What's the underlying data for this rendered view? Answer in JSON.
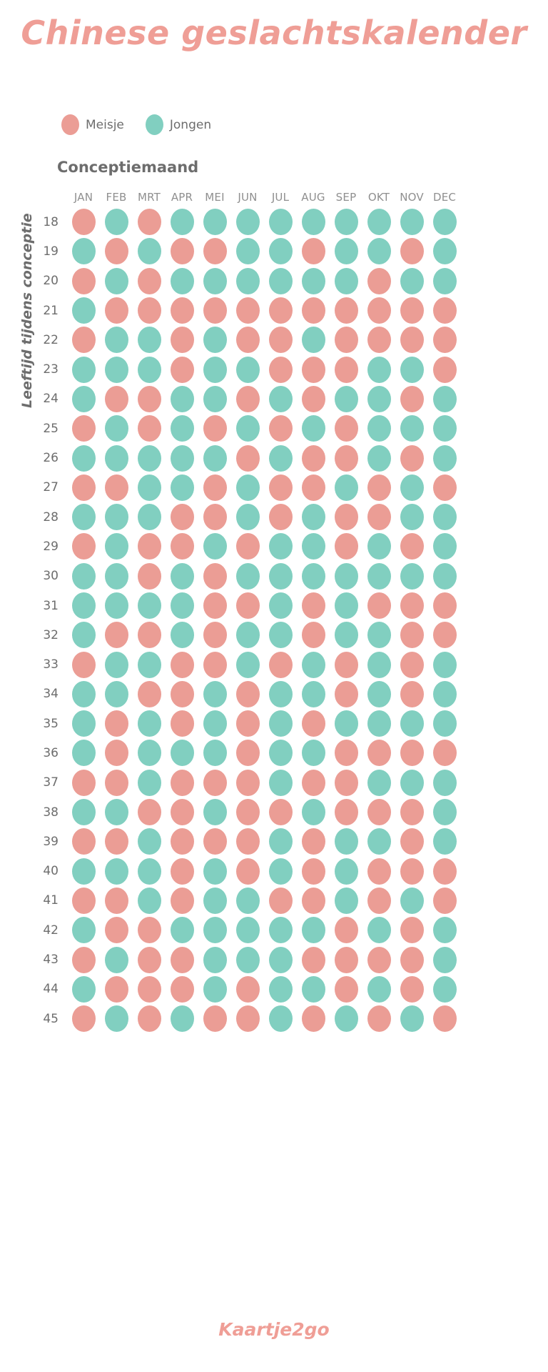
{
  "title": "Chinese geslachtskalender",
  "footer": "Kaartje2go",
  "legend": {
    "girl_label": "Meisje",
    "boy_label": "Jongen",
    "girl_color": "#eb9d95",
    "boy_color": "#81cfc0"
  },
  "axes": {
    "x_title": "Conceptiemaand",
    "y_title": "Leeftijd tijdens conceptie"
  },
  "chart_data": {
    "type": "heatmap",
    "title": "Chinese geslachtskalender",
    "xlabel": "Conceptiemaand",
    "ylabel": "Leeftijd tijdens conceptie",
    "legend": [
      {
        "name": "Meisje",
        "value": "G",
        "color": "#eb9d95"
      },
      {
        "name": "Jongen",
        "value": "B",
        "color": "#81cfc0"
      }
    ],
    "legend_position": "top-left",
    "grid": false,
    "categories": [
      "JAN",
      "FEB",
      "MRT",
      "APR",
      "MEI",
      "JUN",
      "JUL",
      "AUG",
      "SEP",
      "OKT",
      "NOV",
      "DEC"
    ],
    "rows": [
      {
        "age": "18",
        "values": [
          "G",
          "B",
          "G",
          "B",
          "B",
          "B",
          "B",
          "B",
          "B",
          "B",
          "B",
          "B"
        ]
      },
      {
        "age": "19",
        "values": [
          "B",
          "G",
          "B",
          "G",
          "G",
          "B",
          "B",
          "G",
          "B",
          "B",
          "G",
          "B"
        ]
      },
      {
        "age": "20",
        "values": [
          "G",
          "B",
          "G",
          "B",
          "B",
          "B",
          "B",
          "B",
          "B",
          "G",
          "B",
          "B"
        ]
      },
      {
        "age": "21",
        "values": [
          "B",
          "G",
          "G",
          "G",
          "G",
          "G",
          "G",
          "G",
          "G",
          "G",
          "G",
          "G"
        ]
      },
      {
        "age": "22",
        "values": [
          "G",
          "B",
          "B",
          "G",
          "B",
          "G",
          "G",
          "B",
          "G",
          "G",
          "G",
          "G"
        ]
      },
      {
        "age": "23",
        "values": [
          "B",
          "B",
          "B",
          "G",
          "B",
          "B",
          "G",
          "G",
          "G",
          "B",
          "B",
          "G"
        ]
      },
      {
        "age": "24",
        "values": [
          "B",
          "G",
          "G",
          "B",
          "B",
          "G",
          "B",
          "G",
          "B",
          "B",
          "G",
          "B"
        ]
      },
      {
        "age": "25",
        "values": [
          "G",
          "B",
          "G",
          "B",
          "G",
          "B",
          "G",
          "B",
          "G",
          "B",
          "B",
          "B"
        ]
      },
      {
        "age": "26",
        "values": [
          "B",
          "B",
          "B",
          "B",
          "B",
          "G",
          "B",
          "G",
          "G",
          "B",
          "G",
          "B"
        ]
      },
      {
        "age": "27",
        "values": [
          "G",
          "G",
          "B",
          "B",
          "G",
          "B",
          "G",
          "G",
          "B",
          "G",
          "B",
          "G"
        ]
      },
      {
        "age": "28",
        "values": [
          "B",
          "B",
          "B",
          "G",
          "G",
          "B",
          "G",
          "B",
          "G",
          "G",
          "B",
          "B"
        ]
      },
      {
        "age": "29",
        "values": [
          "G",
          "B",
          "G",
          "G",
          "B",
          "G",
          "B",
          "B",
          "G",
          "B",
          "G",
          "B"
        ]
      },
      {
        "age": "30",
        "values": [
          "B",
          "B",
          "G",
          "B",
          "G",
          "B",
          "B",
          "B",
          "B",
          "B",
          "B",
          "B"
        ]
      },
      {
        "age": "31",
        "values": [
          "B",
          "B",
          "B",
          "B",
          "G",
          "G",
          "B",
          "G",
          "B",
          "G",
          "G",
          "G"
        ]
      },
      {
        "age": "32",
        "values": [
          "B",
          "G",
          "G",
          "B",
          "G",
          "B",
          "B",
          "G",
          "B",
          "B",
          "G",
          "G"
        ]
      },
      {
        "age": "33",
        "values": [
          "G",
          "B",
          "B",
          "G",
          "G",
          "B",
          "G",
          "B",
          "G",
          "B",
          "G",
          "B"
        ]
      },
      {
        "age": "34",
        "values": [
          "B",
          "B",
          "G",
          "G",
          "B",
          "G",
          "B",
          "B",
          "G",
          "B",
          "G",
          "B"
        ]
      },
      {
        "age": "35",
        "values": [
          "B",
          "G",
          "B",
          "G",
          "B",
          "G",
          "B",
          "G",
          "B",
          "B",
          "B",
          "B"
        ]
      },
      {
        "age": "36",
        "values": [
          "B",
          "G",
          "B",
          "B",
          "B",
          "G",
          "B",
          "B",
          "G",
          "G",
          "G",
          "G"
        ]
      },
      {
        "age": "37",
        "values": [
          "G",
          "G",
          "B",
          "G",
          "G",
          "G",
          "B",
          "G",
          "G",
          "B",
          "B",
          "B"
        ]
      },
      {
        "age": "38",
        "values": [
          "B",
          "B",
          "G",
          "G",
          "B",
          "G",
          "G",
          "B",
          "G",
          "G",
          "G",
          "B"
        ]
      },
      {
        "age": "39",
        "values": [
          "G",
          "G",
          "B",
          "G",
          "G",
          "G",
          "B",
          "G",
          "B",
          "B",
          "G",
          "B"
        ]
      },
      {
        "age": "40",
        "values": [
          "B",
          "B",
          "B",
          "G",
          "B",
          "G",
          "B",
          "G",
          "B",
          "G",
          "G",
          "G"
        ]
      },
      {
        "age": "41",
        "values": [
          "G",
          "G",
          "B",
          "G",
          "B",
          "B",
          "G",
          "G",
          "B",
          "G",
          "B",
          "G"
        ]
      },
      {
        "age": "42",
        "values": [
          "B",
          "G",
          "G",
          "B",
          "B",
          "B",
          "B",
          "B",
          "G",
          "B",
          "G",
          "B"
        ]
      },
      {
        "age": "43",
        "values": [
          "G",
          "B",
          "G",
          "G",
          "B",
          "B",
          "B",
          "G",
          "G",
          "G",
          "G",
          "B"
        ]
      },
      {
        "age": "44",
        "values": [
          "B",
          "G",
          "G",
          "G",
          "B",
          "G",
          "B",
          "B",
          "G",
          "B",
          "G",
          "B"
        ]
      },
      {
        "age": "45",
        "values": [
          "G",
          "B",
          "G",
          "B",
          "G",
          "G",
          "B",
          "G",
          "B",
          "G",
          "B",
          "G"
        ]
      }
    ]
  }
}
